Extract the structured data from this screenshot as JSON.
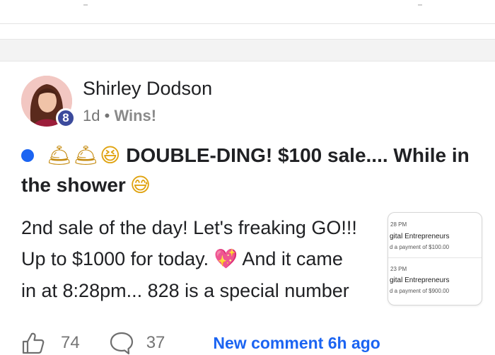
{
  "post": {
    "author": "Shirley Dodson",
    "level": "8",
    "time": "1d",
    "separator": "•",
    "category": "Wins!",
    "title_emojis": [
      "bell-emoji",
      "bell-emoji",
      "squinting-face-emoji"
    ],
    "title_line1": "DOUBLE-DING! $100 sale.... While in",
    "title_line2": "the shower",
    "title_end_emoji": "grinning-face-with-sweat-emoji",
    "body_line1": "2nd sale of the day! Let's freaking GO!!!",
    "body_line2a": "Up to $1000 for today.",
    "body_line2b": "And it came",
    "body_line3": "in at 8:28pm... 828 is a special number",
    "heart_emoji": "sparkling-heart-emoji",
    "colors": {
      "accent": "#1b64f2",
      "badge": "#3b4a9c",
      "muted": "#757575"
    }
  },
  "attachment": {
    "notifications": [
      {
        "time": "28 PM",
        "org": "gital Entrepreneurs",
        "amount": "d a payment of $100.00"
      },
      {
        "time": "23 PM",
        "org": "gital Entrepreneurs",
        "amount": "d a payment of $900.00"
      }
    ]
  },
  "actions": {
    "likes": "74",
    "comments": "37",
    "new_comment": "New comment 6h ago"
  }
}
